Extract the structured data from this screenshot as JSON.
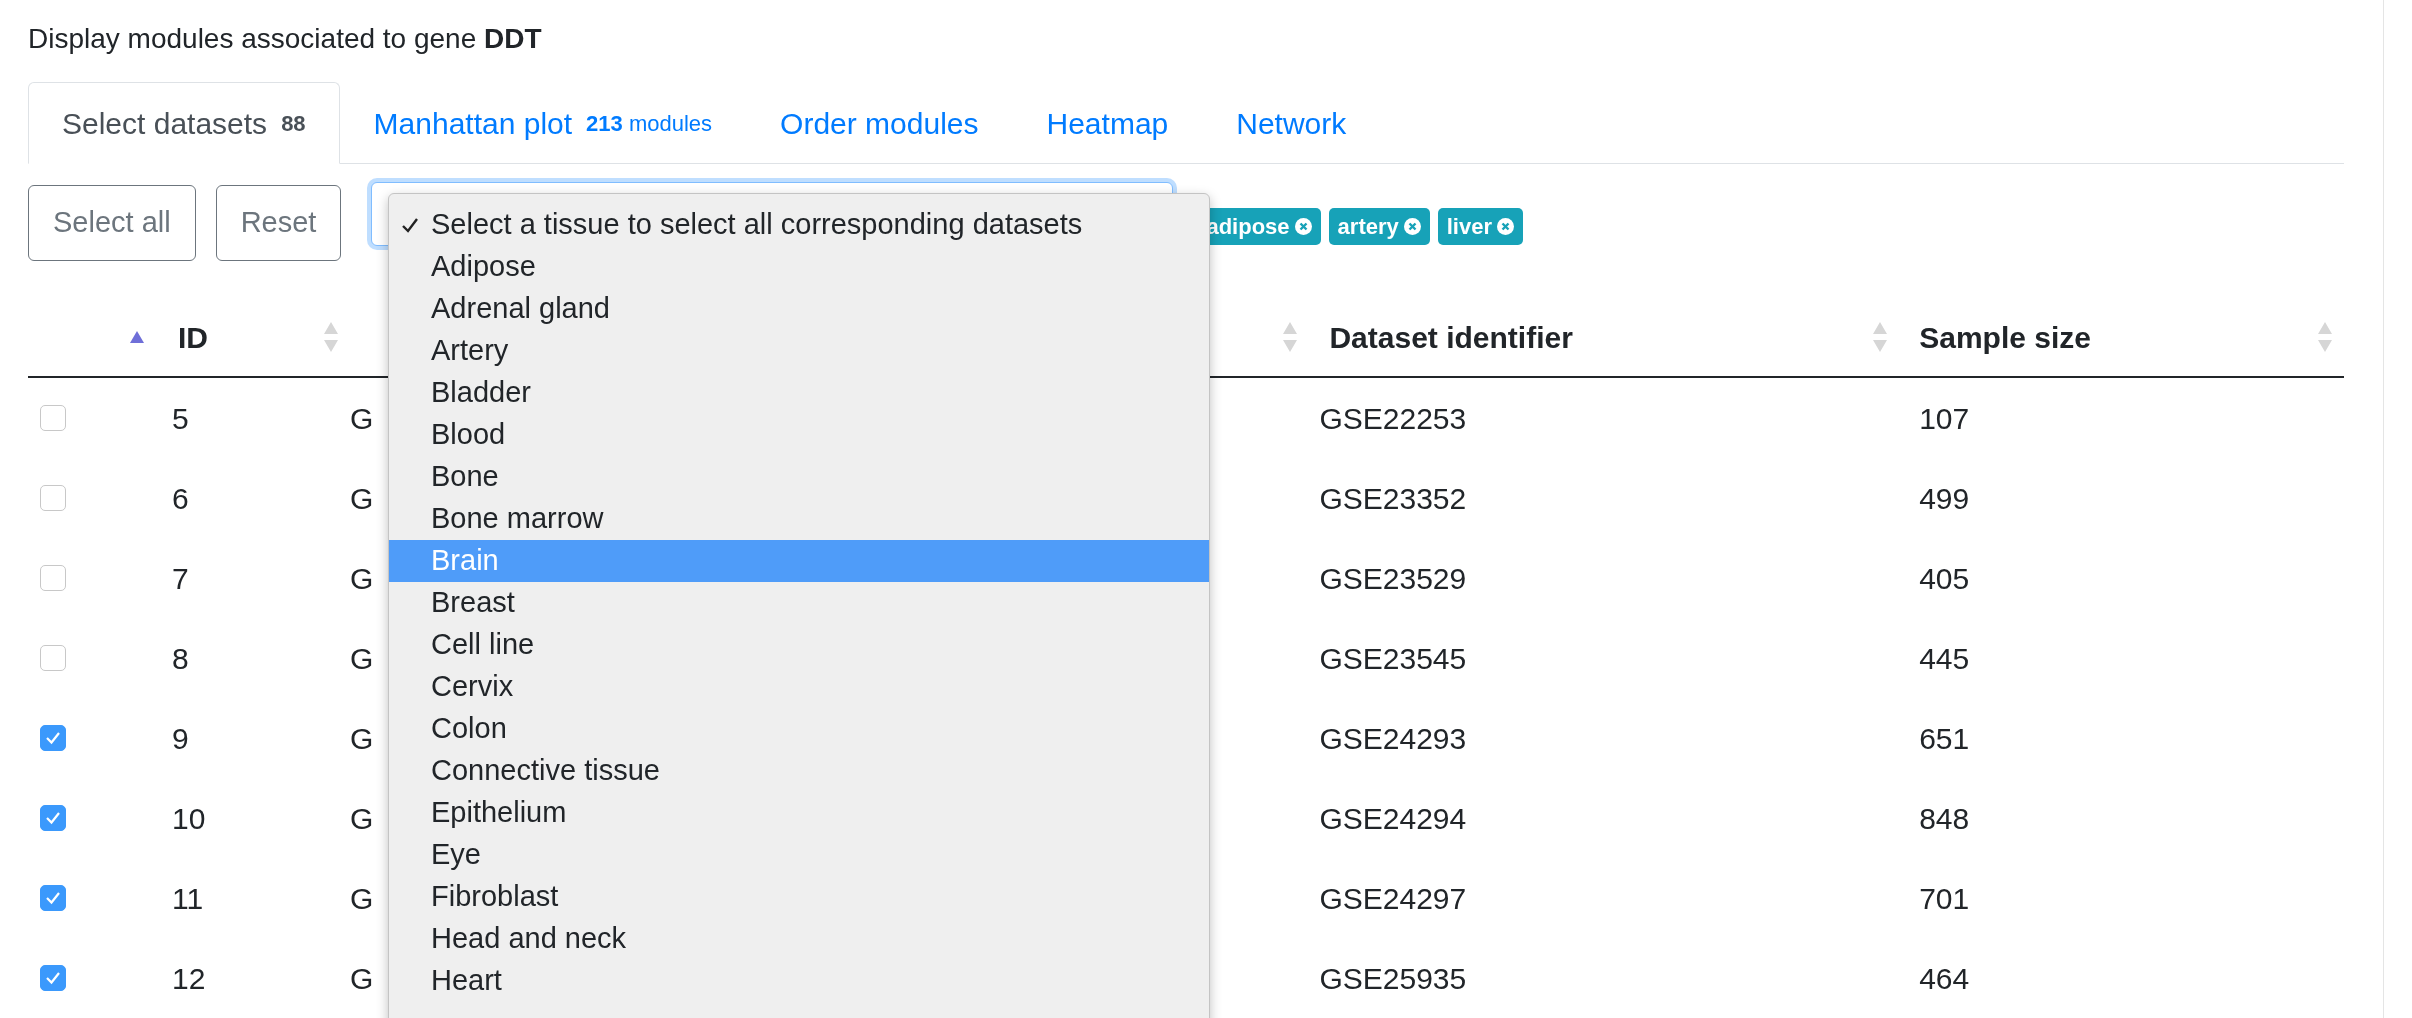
{
  "heading": "Display modules associated to gene **DDT**",
  "tabs": [
    {
      "label": "Select datasets",
      "count": "88",
      "selected": true
    },
    {
      "label": "Manhattan plot",
      "count": "213",
      "unit": "modules",
      "selected": false
    },
    {
      "label": "Order modules",
      "selected": false
    },
    {
      "label": "Heatmap",
      "selected": false
    },
    {
      "label": "Network",
      "selected": false
    }
  ],
  "buttons": [
    "Select all",
    "Reset"
  ],
  "tissue_select": {
    "options": [
      {
        "label": "Select a tissue to select all corresponding datasets",
        "checked": true,
        "selected": false
      },
      {
        "label": "Adipose",
        "checked": false,
        "selected": false
      },
      {
        "label": "Adrenal gland",
        "checked": false,
        "selected": false
      },
      {
        "label": "Artery",
        "checked": false,
        "selected": false
      },
      {
        "label": "Bladder",
        "checked": false,
        "selected": false
      },
      {
        "label": "Blood",
        "checked": false,
        "selected": false
      },
      {
        "label": "Bone",
        "checked": false,
        "selected": false
      },
      {
        "label": "Bone marrow",
        "checked": false,
        "selected": false
      },
      {
        "label": "Brain",
        "checked": false,
        "selected": true
      },
      {
        "label": "Breast",
        "checked": false,
        "selected": false
      },
      {
        "label": "Cell line",
        "checked": false,
        "selected": false
      },
      {
        "label": "Cervix",
        "checked": false,
        "selected": false
      },
      {
        "label": "Colon",
        "checked": false,
        "selected": false
      },
      {
        "label": "Connective tissue",
        "checked": false,
        "selected": false
      },
      {
        "label": "Epithelium",
        "checked": false,
        "selected": false
      },
      {
        "label": "Eye",
        "checked": false,
        "selected": false
      },
      {
        "label": "Fibroblast",
        "checked": false,
        "selected": false
      },
      {
        "label": "Head and neck",
        "checked": false,
        "selected": false
      },
      {
        "label": "Heart",
        "checked": false,
        "selected": false
      }
    ]
  },
  "tags": [
    "adipose",
    "artery",
    "liver"
  ],
  "table": {
    "columns": [
      {
        "label": "ID",
        "sorted": true
      },
      {
        "sorted": false
      },
      {
        "label": "Dataset identifier",
        "sorted": false
      },
      {
        "label": "Sample size",
        "sorted": false
      }
    ],
    "rows": [
      {
        "checked": false,
        "id": "5",
        "column_3": "G",
        "dataset": "GSE22253",
        "sample_size": "107"
      },
      {
        "checked": false,
        "id": "6",
        "column_3": "G",
        "dataset": "GSE23352",
        "sample_size": "499"
      },
      {
        "checked": false,
        "id": "7",
        "column_3": "G",
        "dataset": "GSE23529",
        "sample_size": "405"
      },
      {
        "checked": false,
        "id": "8",
        "column_3": "G",
        "dataset": "GSE23545",
        "sample_size": "445"
      },
      {
        "checked": true,
        "id": "9",
        "column_3": "G",
        "dataset": "GSE24293",
        "sample_size": "651"
      },
      {
        "checked": true,
        "id": "10",
        "column_3": "G",
        "dataset": "GSE24294",
        "sample_size": "848"
      },
      {
        "checked": true,
        "id": "11",
        "column_3": "G",
        "dataset": "GSE24297",
        "sample_size": "701"
      },
      {
        "checked": true,
        "id": "12",
        "column_3": "G",
        "dataset": "GSE25935",
        "sample_size": "464"
      }
    ]
  }
}
